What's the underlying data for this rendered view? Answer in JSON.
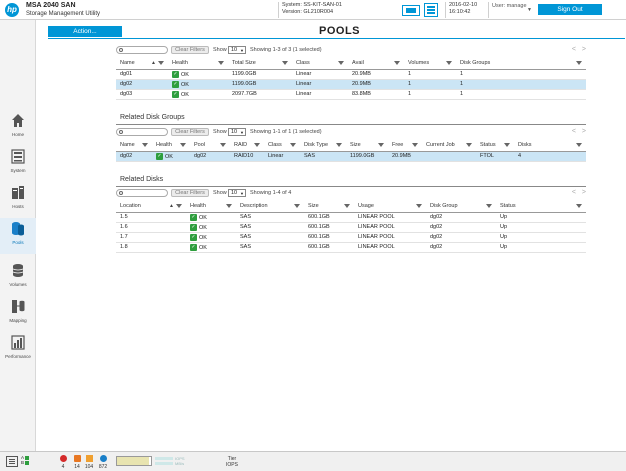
{
  "header": {
    "logo": "hp",
    "product_name": "MSA 2040 SAN",
    "product_sub": "Storage Management Utility",
    "system_label": "System: SS-KIT-SAN-01",
    "version_label": "Version: GL210R004",
    "date": "2016-02-10",
    "time": "16:10:42",
    "user_label": "User: manage",
    "sign_out": "Sign Out"
  },
  "nav": {
    "items": [
      {
        "label": "Home",
        "icon": "home-icon"
      },
      {
        "label": "System",
        "icon": "system-icon"
      },
      {
        "label": "Hosts",
        "icon": "hosts-icon"
      },
      {
        "label": "Pools",
        "icon": "pools-icon",
        "active": true
      },
      {
        "label": "Volumes",
        "icon": "volumes-icon"
      },
      {
        "label": "Mapping",
        "icon": "mapping-icon"
      },
      {
        "label": "Performance",
        "icon": "performance-icon"
      }
    ]
  },
  "main": {
    "action_label": "Action...",
    "page_title": "POOLS"
  },
  "pools": {
    "filter_label": "Clear Filters",
    "show_label": "Show",
    "show_value": "10",
    "showing": "Showing 1-3 of 3 (1 selected)",
    "columns": [
      "Name",
      "Health",
      "Total Size",
      "Class",
      "Avail",
      "Volumes",
      "Disk Groups"
    ],
    "rows": [
      [
        "dg01",
        "OK",
        "1199.0GB",
        "Linear",
        "20.9MB",
        "1",
        "1"
      ],
      [
        "dg02",
        "OK",
        "1199.0GB",
        "Linear",
        "20.9MB",
        "1",
        "1"
      ],
      [
        "dg03",
        "OK",
        "2097.7GB",
        "Linear",
        "83.8MB",
        "1",
        "1"
      ]
    ],
    "selected_index": 1
  },
  "disk_groups": {
    "title": "Related Disk Groups",
    "filter_label": "Clear Filters",
    "show_label": "Show",
    "show_value": "10",
    "showing": "Showing 1-1 of 1 (1 selected)",
    "columns": [
      "Name",
      "Health",
      "Pool",
      "RAID",
      "Class",
      "Disk Type",
      "Size",
      "Free",
      "Current Job",
      "Status",
      "Disks"
    ],
    "rows": [
      [
        "dg02",
        "OK",
        "dg02",
        "RAID10",
        "Linear",
        "SAS",
        "1199.0GB",
        "20.9MB",
        "",
        "FTOL",
        "4"
      ]
    ]
  },
  "disks": {
    "title": "Related Disks",
    "filter_label": "Clear Filters",
    "show_label": "Show",
    "show_value": "10",
    "showing": "Showing 1-4 of 4",
    "columns": [
      "Location",
      "Health",
      "Description",
      "Size",
      "Usage",
      "Disk Group",
      "Status"
    ],
    "rows": [
      [
        "1.5",
        "OK",
        "SAS",
        "600.1GB",
        "LINEAR POOL",
        "dg02",
        "Up"
      ],
      [
        "1.6",
        "OK",
        "SAS",
        "600.1GB",
        "LINEAR POOL",
        "dg02",
        "Up"
      ],
      [
        "1.7",
        "OK",
        "SAS",
        "600.1GB",
        "LINEAR POOL",
        "dg02",
        "Up"
      ],
      [
        "1.8",
        "OK",
        "SAS",
        "600.1GB",
        "LINEAR POOL",
        "dg02",
        "Up"
      ]
    ]
  },
  "footer": {
    "mini_a": "A",
    "mini_b": "B",
    "critical": "4",
    "error": "14",
    "warning": "104",
    "info": "872",
    "iops_label": "IOPS",
    "mbs_label": "MB/s",
    "tier_label": "Tier",
    "tier_iops": "IOPS"
  },
  "colors": {
    "accent": "#0096d6",
    "selected_row": "#cbe5f5",
    "ok_green": "#2e9e3e",
    "critical": "#d42a2a",
    "error": "#e87722",
    "warning": "#f0a030",
    "info": "#1a7fc8"
  }
}
